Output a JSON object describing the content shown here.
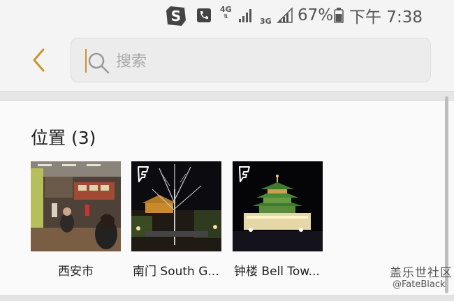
{
  "status_bar": {
    "app_icon_letter": "S",
    "network_1": "4G",
    "network_2": "3G",
    "battery": "67%",
    "time": "下午 7:38",
    "icons": [
      "app-s-icon",
      "phone-icon",
      "signal-icon",
      "battery-icon"
    ]
  },
  "header": {
    "back_icon": "chevron-left-icon",
    "search_placeholder": "搜索",
    "accent": "#c9952d"
  },
  "locations": {
    "title": "位置 (3)",
    "items": [
      {
        "label": "西安市",
        "badge": ""
      },
      {
        "label": "南门 South G...",
        "badge": "foursquare-icon"
      },
      {
        "label": "钟楼 Bell Tow...",
        "badge": "foursquare-icon"
      }
    ]
  },
  "watermark": {
    "main": "盖乐世社区",
    "sub": "@FateBlack"
  }
}
